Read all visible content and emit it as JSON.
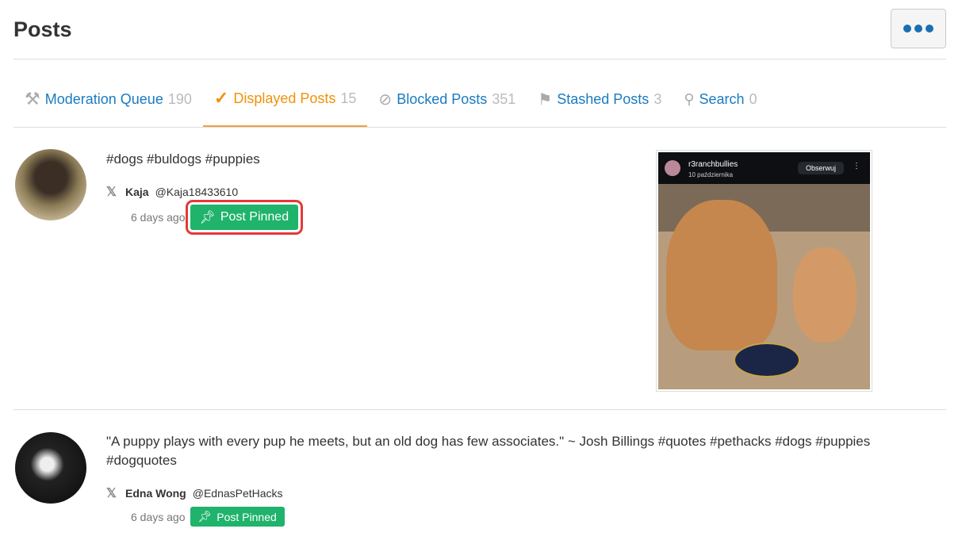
{
  "header": {
    "title": "Posts",
    "more_label": "More options"
  },
  "tabs": [
    {
      "label": "Moderation Queue",
      "count": "190",
      "icon": "gavel-icon",
      "color": "#1a7bbf"
    },
    {
      "label": "Displayed Posts",
      "count": "15",
      "icon": "check-icon",
      "active": true,
      "color": "#f0920b"
    },
    {
      "label": "Blocked Posts",
      "count": "351",
      "icon": "blocked-icon"
    },
    {
      "label": "Stashed Posts",
      "count": "3",
      "icon": "flag-icon"
    },
    {
      "label": "Search",
      "count": "0",
      "icon": "search-icon"
    }
  ],
  "posts": [
    {
      "text": "#dogs #buldogs #puppies",
      "source_icon": "x-icon",
      "author": "Kaja",
      "handle": "@Kaja18433610",
      "time": "6 days ago",
      "pin_label": "Post Pinned",
      "image": {
        "account": "r3ranchbullies",
        "date": "10 października",
        "follow": "Obserwuj"
      }
    },
    {
      "text": "\"A puppy plays with every pup he meets, but an old dog has few associates.\" ~ Josh Billings #quotes #pethacks #dogs #puppies #dogquotes",
      "source_icon": "x-icon",
      "author": "Edna Wong",
      "handle": "@EdnasPetHacks",
      "time": "6 days ago",
      "pin_label": "Post Pinned"
    }
  ],
  "colors": {
    "accent": "#f0920b",
    "link": "#1a7bbf",
    "pinned": "#1fb36b",
    "highlight": "#e53935"
  }
}
